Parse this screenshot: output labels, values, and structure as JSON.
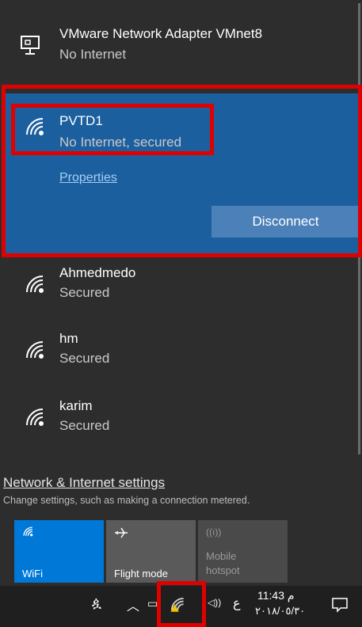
{
  "networks": {
    "vmware": {
      "name": "VMware Network Adapter VMnet8",
      "status": "No Internet"
    },
    "connected": {
      "name": "PVTD1",
      "status": "No Internet, secured",
      "properties": "Properties",
      "disconnect": "Disconnect"
    },
    "others": [
      {
        "name": "Ahmedmedo",
        "status": "Secured"
      },
      {
        "name": "hm",
        "status": "Secured"
      },
      {
        "name": "karim",
        "status": "Secured"
      }
    ]
  },
  "settings": {
    "link": "Network & Internet settings",
    "description": "Change settings, such as making a connection metered."
  },
  "quick_actions": [
    {
      "label": "WiFi",
      "icon": "wifi-icon"
    },
    {
      "label": "Flight mode",
      "icon": "airplane-icon"
    },
    {
      "label": "Mobile hotspot",
      "line1": "Mobile",
      "line2": "hotspot",
      "icon": "hotspot-icon"
    }
  ],
  "taskbar": {
    "language": "ع",
    "time": "11:43 م",
    "date": "٢٠١٨/٠٥/٣٠"
  },
  "colors": {
    "panel_bg": "#2d2d2d",
    "selected_bg": "#1b5f9e",
    "accent": "#0078d7",
    "highlight_box": "#e00000"
  }
}
